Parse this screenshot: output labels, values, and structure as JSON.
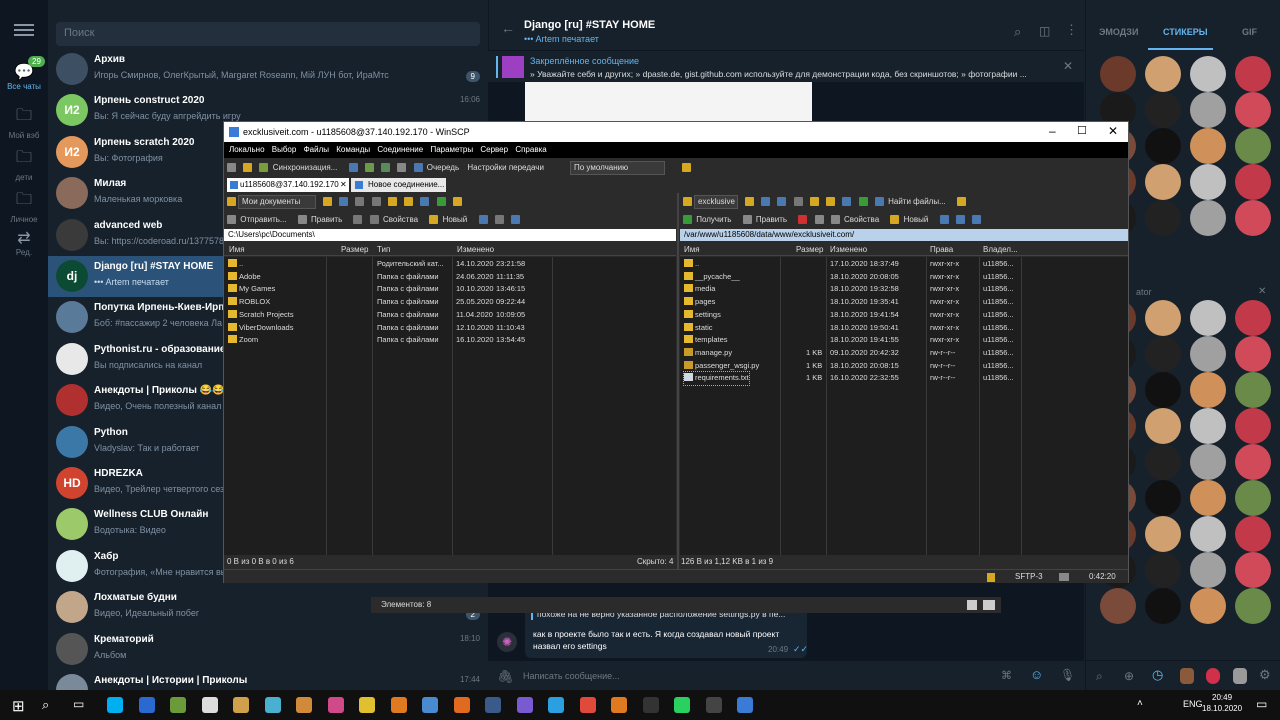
{
  "rail": {
    "items": [
      {
        "label": "Все чаты",
        "icon": "chats-icon",
        "badge": "29"
      },
      {
        "label": "Мой вэб",
        "icon": "folder-icon"
      },
      {
        "label": "дети",
        "icon": "folder-icon"
      },
      {
        "label": "Личное",
        "icon": "folder-icon"
      },
      {
        "label": "Ред.",
        "icon": "edit-folders-icon"
      }
    ]
  },
  "search": {
    "placeholder": "Поиск"
  },
  "chats": [
    {
      "title": "Архив",
      "preview": "Игорь Смирнов, ОлегКрытый, Margaret Roseann, Мій ЛУН бот, ИраМтс",
      "time": "",
      "badge": "9",
      "avatar": "",
      "color": "#3d4f63"
    },
    {
      "title": "Ирпень construct 2020",
      "preview": "Вы: Я сейчас буду апгрейдить игру",
      "time": "16:06",
      "badge": "",
      "avatar": "И2",
      "color": "#7bc862"
    },
    {
      "title": "Ирпень scratch 2020",
      "preview": "Вы: Фотография",
      "time": "",
      "badge": "",
      "avatar": "И2",
      "color": "#e5985c"
    },
    {
      "title": "Милая",
      "preview": "Маленькая морковка",
      "time": "",
      "badge": "",
      "avatar": "",
      "color": "#8a6a5a"
    },
    {
      "title": "advanced web",
      "preview": "Вы: https://coderoad.ru/1377578",
      "time": "",
      "badge": "",
      "avatar": "",
      "color": "#3a3a3a"
    },
    {
      "title": "Django [ru] #STAY HOME",
      "preview": "••• Artem печатает",
      "time": "",
      "badge": "",
      "avatar": "dj",
      "color": "#0c4b33"
    },
    {
      "title": "Попутка Ирпень-Киев-Ирп",
      "preview": "Боб: #пассажир 2 человека Ла",
      "time": "",
      "badge": "",
      "avatar": "",
      "color": "#5a7a9a"
    },
    {
      "title": "Pythonist.ru - образование",
      "preview": "Вы подписались на канал",
      "time": "",
      "badge": "",
      "avatar": "",
      "color": "#e8e8e8"
    },
    {
      "title": "Анекдоты | Приколы 😂😂",
      "preview": "Видео, Очень полезный канал",
      "time": "",
      "badge": "",
      "avatar": "",
      "color": "#b03030"
    },
    {
      "title": "Python",
      "preview": "Vladyslav: Так и работает",
      "time": "",
      "badge": "",
      "avatar": "",
      "color": "#3b78a8"
    },
    {
      "title": "HDREZKA",
      "preview": "Видео, Трейлер четвертого сезо",
      "time": "",
      "badge": "",
      "avatar": "HD",
      "color": "#d0432f"
    },
    {
      "title": "Wellness CLUB Онлайн",
      "preview": "Водотыка: Видео",
      "time": "",
      "badge": "",
      "avatar": "",
      "color": "#9cc96a"
    },
    {
      "title": "Хабр",
      "preview": "Фотография, «Мне нравится вы",
      "time": "",
      "badge": "",
      "avatar": "",
      "color": "#e0f0f0"
    },
    {
      "title": "Лохматые будни",
      "preview": "Видео, Идеальный побег",
      "time": "",
      "badge": "2",
      "avatar": "",
      "color": "#c2a68a"
    },
    {
      "title": "Крематорий",
      "preview": "Альбом",
      "time": "18:10",
      "badge": "",
      "avatar": "",
      "color": "#555555"
    },
    {
      "title": "Анекдоты | Истории | Приколы",
      "preview": "",
      "time": "17:44",
      "badge": "",
      "avatar": "",
      "color": "#7a8a9a"
    }
  ],
  "header": {
    "title": "Django [ru] #STAY HOME",
    "status": "••• Artem печатает"
  },
  "pinned": {
    "title": "Закреплённое сообщение",
    "text": "» Уважайте себя и других; » dpaste.de, gist.github.com используйте для демонстрации кода, без скриншотов; » фотографии ..."
  },
  "messages": {
    "reply_quote": "похоже на не верно указанное расположение settings.py в пе...",
    "text1": "как в проекте было так и есть. Я когда создавал новый проект",
    "text2": "назвал его settings",
    "time": "20:49",
    "elements_label": "Элементов: 8"
  },
  "input": {
    "placeholder": "Написать сообщение..."
  },
  "panel": {
    "tabs": [
      "ЭМОДЗИ",
      "СТИКЕРЫ",
      "GIF"
    ],
    "section": "ator"
  },
  "winscp": {
    "title": "excklusiveit.com - u1185608@37.140.192.170 - WinSCP",
    "menu": [
      "Локально",
      "Выбор",
      "Файлы",
      "Команды",
      "Соединение",
      "Параметры",
      "Сервер",
      "Справка"
    ],
    "toolbar": {
      "sync": "Синхронизация...",
      "queue": "Очередь",
      "transfer_settings": "Настройки передачи",
      "transfer_default": "По умолчанию"
    },
    "tabs": [
      "u1185608@37.140.192.170",
      "Новое соединение..."
    ],
    "left": {
      "location": "Мои документы",
      "send": "Отправить...",
      "edit": "Править",
      "props": "Свойства",
      "new": "Новый",
      "path": "C:\\Users\\pc\\Documents\\",
      "columns": [
        "Имя",
        "Размер",
        "Тип",
        "Изменено"
      ],
      "rows": [
        {
          "name": "..",
          "size": "",
          "type": "Родительский кат...",
          "date": "14.10.2020",
          "time": "23:21:58"
        },
        {
          "name": "Adobe",
          "size": "",
          "type": "Папка с файлами",
          "date": "24.06.2020",
          "time": "11:11:35"
        },
        {
          "name": "My Games",
          "size": "",
          "type": "Папка с файлами",
          "date": "10.10.2020",
          "time": "13:46:15"
        },
        {
          "name": "ROBLOX",
          "size": "",
          "type": "Папка с файлами",
          "date": "25.05.2020",
          "time": "09:22:44"
        },
        {
          "name": "Scratch Projects",
          "size": "",
          "type": "Папка с файлами",
          "date": "11.04.2020",
          "time": "10:09:05"
        },
        {
          "name": "ViberDownloads",
          "size": "",
          "type": "Папка с файлами",
          "date": "12.10.2020",
          "time": "11:10:43"
        },
        {
          "name": "Zoom",
          "size": "",
          "type": "Папка с файлами",
          "date": "16.10.2020",
          "time": "13:54:45"
        }
      ],
      "status": "0 B из 0 B в 0 из 6",
      "hidden": "Скрыто: 4"
    },
    "right": {
      "location": "excklusive",
      "find": "Найти файлы...",
      "receive": "Получить",
      "edit": "Править",
      "props": "Свойства",
      "new": "Новый",
      "path": "/var/www/u1185608/data/www/excklusiveit.com/",
      "columns": [
        "Имя",
        "Размер",
        "Изменено",
        "Права",
        "Владел..."
      ],
      "rows": [
        {
          "name": "..",
          "size": "",
          "date": "17.10.2020 18:37:49",
          "perm": "rwxr-xr-x",
          "owner": "u11856...",
          "kind": "dir"
        },
        {
          "name": "__pycache__",
          "size": "",
          "date": "18.10.2020 20:08:05",
          "perm": "rwxr-xr-x",
          "owner": "u11856...",
          "kind": "dir"
        },
        {
          "name": "media",
          "size": "",
          "date": "18.10.2020 19:32:58",
          "perm": "rwxr-xr-x",
          "owner": "u11856...",
          "kind": "dir"
        },
        {
          "name": "pages",
          "size": "",
          "date": "18.10.2020 19:35:41",
          "perm": "rwxr-xr-x",
          "owner": "u11856...",
          "kind": "dir"
        },
        {
          "name": "settings",
          "size": "",
          "date": "18.10.2020 19:41:54",
          "perm": "rwxr-xr-x",
          "owner": "u11856...",
          "kind": "dir"
        },
        {
          "name": "static",
          "size": "",
          "date": "18.10.2020 19:50:41",
          "perm": "rwxr-xr-x",
          "owner": "u11856...",
          "kind": "dir"
        },
        {
          "name": "templates",
          "size": "",
          "date": "18.10.2020 19:41:55",
          "perm": "rwxr-xr-x",
          "owner": "u11856...",
          "kind": "dir"
        },
        {
          "name": "manage.py",
          "size": "1 KB",
          "date": "09.10.2020 20:42:32",
          "perm": "rw-r--r--",
          "owner": "u11856...",
          "kind": "py"
        },
        {
          "name": "passenger_wsgi.py",
          "size": "1 KB",
          "date": "18.10.2020 20:08:15",
          "perm": "rw-r--r--",
          "owner": "u11856...",
          "kind": "py"
        },
        {
          "name": "requirements.txt",
          "size": "1 KB",
          "date": "16.10.2020 22:32:55",
          "perm": "rw-r--r--",
          "owner": "u11856...",
          "kind": "file"
        }
      ],
      "status": "126 B из 1,12 KB в 1 из 9"
    },
    "protocol": "SFTP-3",
    "timer": "0:42:20"
  },
  "taskbar": {
    "lang": "ENG",
    "time": "20:49",
    "date": "18.10.2020"
  }
}
